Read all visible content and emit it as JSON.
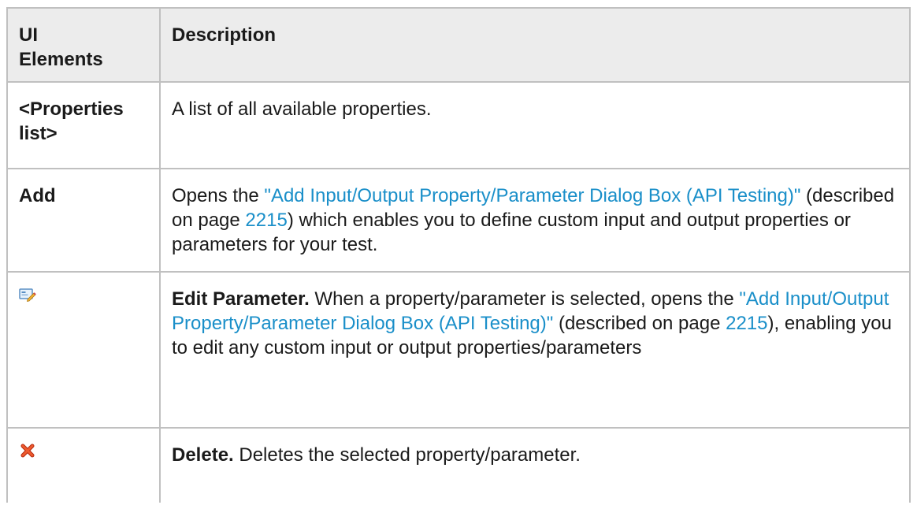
{
  "table": {
    "headers": [
      "UI Elements",
      "Description"
    ],
    "header_line1": "UI",
    "header_line2": "Elements",
    "rows": [
      {
        "element": "<Properties list>",
        "element_line1": "<Properties",
        "element_line2": "list>",
        "description": "A list of all available properties."
      },
      {
        "element": "Add",
        "desc_prefix": "Opens the ",
        "desc_link": "\"Add Input/Output Property/Parameter Dialog Box (API Testing)\"",
        "desc_mid": " (described on page ",
        "desc_page": "2215",
        "desc_suffix": ") which enables you to define custom input and output properties or parameters for your test."
      },
      {
        "element_icon": "edit-parameter-icon",
        "desc_bold": "Edit Parameter.",
        "desc_prefix": " When a property/parameter is selected, opens the ",
        "desc_link": "\"Add Input/Output Property/Parameter Dialog Box (API Testing)\"",
        "desc_mid": " (described on page ",
        "desc_page": "2215",
        "desc_suffix": "), enabling you to edit any custom input or output properties/parameters"
      },
      {
        "element_icon": "delete-x-icon",
        "desc_bold": "Delete.",
        "desc_suffix": " Deletes the selected property/parameter."
      }
    ]
  },
  "colors": {
    "link": "#1a8fc9",
    "header_bg": "#ececec",
    "border": "#c0c0c0",
    "delete_icon": "#e0401a"
  }
}
